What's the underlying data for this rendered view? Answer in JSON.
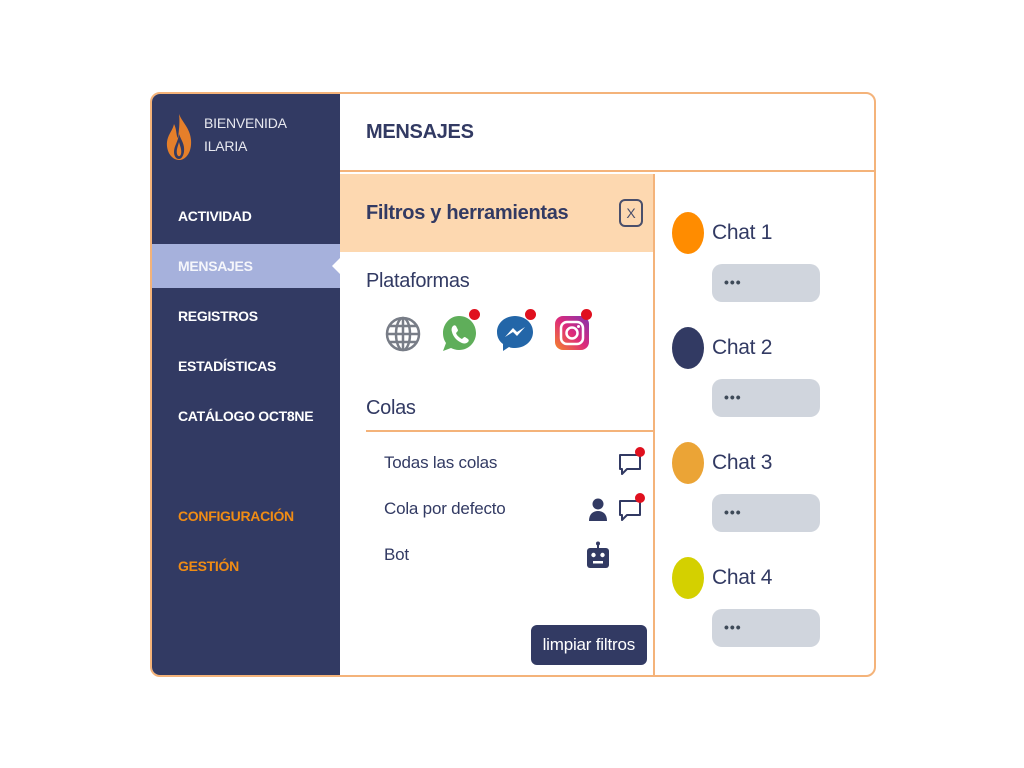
{
  "brand": {
    "greeting": "BIENVENIDA",
    "user": "ILARIA",
    "logo_icon": "flame-icon",
    "logo_color": "#e57f2a"
  },
  "sidebar": {
    "items": [
      {
        "label": "ACTIVIDAD",
        "active": false
      },
      {
        "label": "MENSAJES",
        "active": true
      },
      {
        "label": "REGISTROS",
        "active": false
      },
      {
        "label": "ESTADÍSTICAS",
        "active": false
      },
      {
        "label": "CATÁLOGO OCT8NE",
        "active": false
      }
    ],
    "secondary": [
      {
        "label": "CONFIGURACIÓN"
      },
      {
        "label": "GESTIÓN"
      }
    ],
    "bg_color": "#323a63",
    "active_color": "#a6b1dc",
    "accent_color": "#f08c14"
  },
  "header": {
    "title": "MENSAJES"
  },
  "filters": {
    "title": "Filtros y herramientas",
    "close_label": "X",
    "platforms_title": "Plataformas",
    "platforms": [
      {
        "name": "web",
        "icon": "globe-icon",
        "notification": false
      },
      {
        "name": "whatsapp",
        "icon": "whatsapp-icon",
        "notification": true
      },
      {
        "name": "messenger",
        "icon": "messenger-icon",
        "notification": true
      },
      {
        "name": "instagram",
        "icon": "instagram-icon",
        "notification": true
      }
    ],
    "queues_title": "Colas",
    "queues": [
      {
        "label": "Todas las colas",
        "icons": [
          "chat-bubble-icon"
        ],
        "notification": true
      },
      {
        "label": "Cola por defecto",
        "icons": [
          "user-icon",
          "chat-bubble-icon"
        ],
        "notification": true
      },
      {
        "label": "Bot",
        "icons": [
          "robot-icon"
        ],
        "notification": false
      }
    ],
    "clear_label": "limpiar filtros"
  },
  "chats": [
    {
      "name": "Chat 1",
      "preview": "•••",
      "color": "#ff8c00"
    },
    {
      "name": "Chat 2",
      "preview": "•••",
      "color": "#323a63"
    },
    {
      "name": "Chat 3",
      "preview": "•••",
      "color": "#eba436"
    },
    {
      "name": "Chat 4",
      "preview": "•••",
      "color": "#d4d000"
    }
  ]
}
